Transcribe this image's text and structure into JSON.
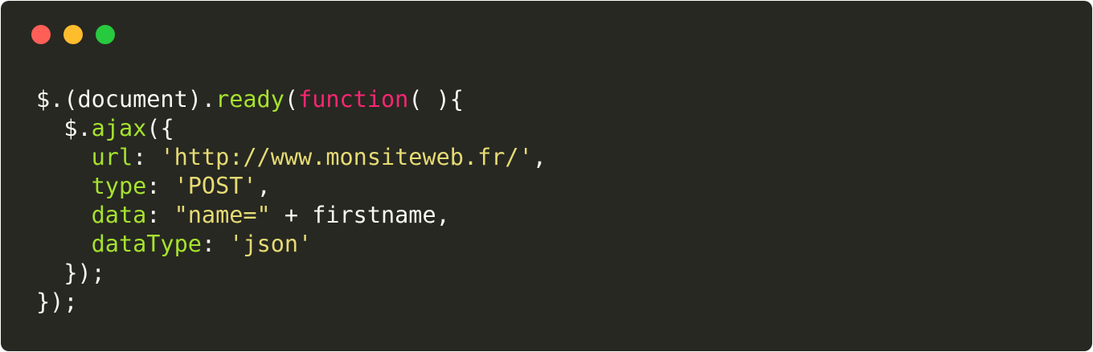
{
  "window": {
    "controls": [
      {
        "name": "close",
        "color": "#ff5f56"
      },
      {
        "name": "minimize",
        "color": "#ffbd2e"
      },
      {
        "name": "zoom",
        "color": "#27c93f"
      }
    ]
  },
  "colors": {
    "background": "#272822",
    "plain": "#f8f8f2",
    "function": "#a6e22e",
    "keyword": "#f92672",
    "string": "#e6db74"
  },
  "code": {
    "lines": [
      [
        {
          "t": "plain",
          "text": "$.(document)."
        },
        {
          "t": "fn",
          "text": "ready"
        },
        {
          "t": "plain",
          "text": "("
        },
        {
          "t": "kw",
          "text": "function"
        },
        {
          "t": "plain",
          "text": "( ){"
        }
      ],
      [
        {
          "t": "plain",
          "text": "  $."
        },
        {
          "t": "fn",
          "text": "ajax"
        },
        {
          "t": "plain",
          "text": "({"
        }
      ],
      [
        {
          "t": "plain",
          "text": "    "
        },
        {
          "t": "fn",
          "text": "url"
        },
        {
          "t": "plain",
          "text": ": "
        },
        {
          "t": "str",
          "text": "'http://www.monsiteweb.fr/'"
        },
        {
          "t": "plain",
          "text": ","
        }
      ],
      [
        {
          "t": "plain",
          "text": "    "
        },
        {
          "t": "fn",
          "text": "type"
        },
        {
          "t": "plain",
          "text": ": "
        },
        {
          "t": "str",
          "text": "'POST'"
        },
        {
          "t": "plain",
          "text": ","
        }
      ],
      [
        {
          "t": "plain",
          "text": "    "
        },
        {
          "t": "fn",
          "text": "data"
        },
        {
          "t": "plain",
          "text": ": "
        },
        {
          "t": "str",
          "text": "\"name=\""
        },
        {
          "t": "plain",
          "text": " + firstname,"
        }
      ],
      [
        {
          "t": "plain",
          "text": "    "
        },
        {
          "t": "fn",
          "text": "dataType"
        },
        {
          "t": "plain",
          "text": ": "
        },
        {
          "t": "str",
          "text": "'json'"
        }
      ],
      [
        {
          "t": "plain",
          "text": "  });"
        }
      ],
      [
        {
          "t": "plain",
          "text": "});"
        }
      ]
    ]
  }
}
